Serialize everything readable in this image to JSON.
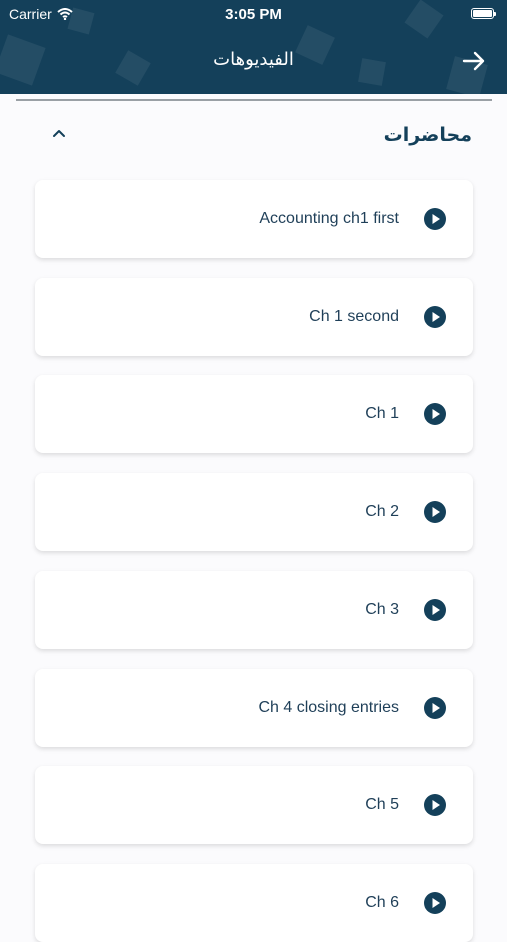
{
  "status_bar": {
    "carrier": "Carrier",
    "time": "3:05 PM"
  },
  "header": {
    "title": "الفيديوهات",
    "back_icon": "arrow-right-icon"
  },
  "section": {
    "title": "محاضرات",
    "chevron_icon": "chevron-up-icon"
  },
  "videos": [
    {
      "label": "Accounting ch1 first",
      "icon": "play-circle-icon"
    },
    {
      "label": "Ch 1 second",
      "icon": "play-circle-icon"
    },
    {
      "label": "Ch 1",
      "icon": "play-circle-icon"
    },
    {
      "label": "Ch 2",
      "icon": "play-circle-icon"
    },
    {
      "label": "Ch 3",
      "icon": "play-circle-icon"
    },
    {
      "label": "Ch 4 closing entries",
      "icon": "play-circle-icon"
    },
    {
      "label": "Ch 5",
      "icon": "play-circle-icon"
    },
    {
      "label": "Ch 6",
      "icon": "play-circle-icon"
    }
  ],
  "colors": {
    "header_bg": "#14405a",
    "accent": "#14405a",
    "text": "#1f3f58",
    "background": "#fbfbfd"
  }
}
